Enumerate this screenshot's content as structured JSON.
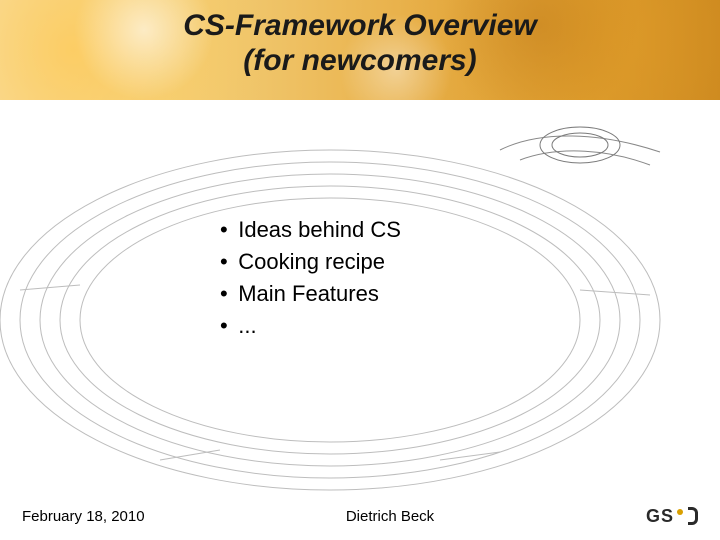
{
  "title_line1": "CS-Framework Overview",
  "title_line2": "(for newcomers)",
  "bullets": {
    "b0": "Ideas behind CS",
    "b1": "Cooking recipe",
    "b2": "Main Features",
    "b3": "..."
  },
  "footer": {
    "date": "February 18, 2010",
    "author": "Dietrich Beck",
    "logo_text": "GS"
  }
}
